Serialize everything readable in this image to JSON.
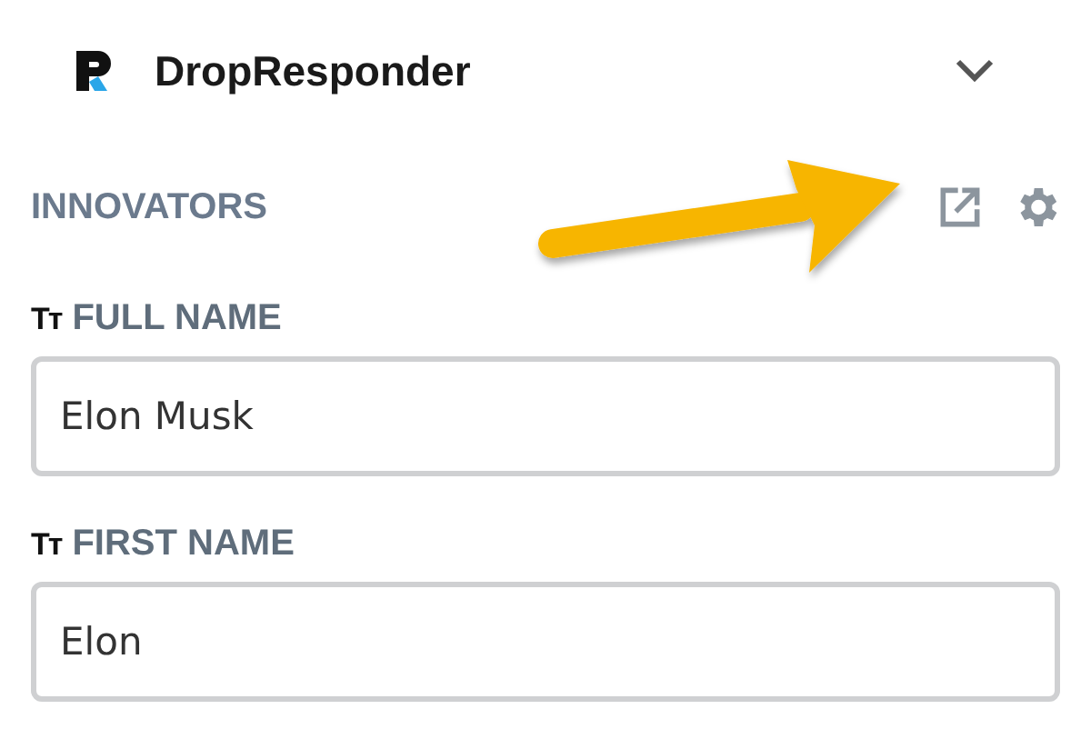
{
  "header": {
    "app_name": "DropResponder"
  },
  "section": {
    "title": "INNOVATORS"
  },
  "fields": [
    {
      "type_marker": "Tᴛ",
      "label": "FULL NAME",
      "value": "Elon Musk"
    },
    {
      "type_marker": "Tᴛ",
      "label": "FIRST NAME",
      "value": "Elon"
    }
  ]
}
